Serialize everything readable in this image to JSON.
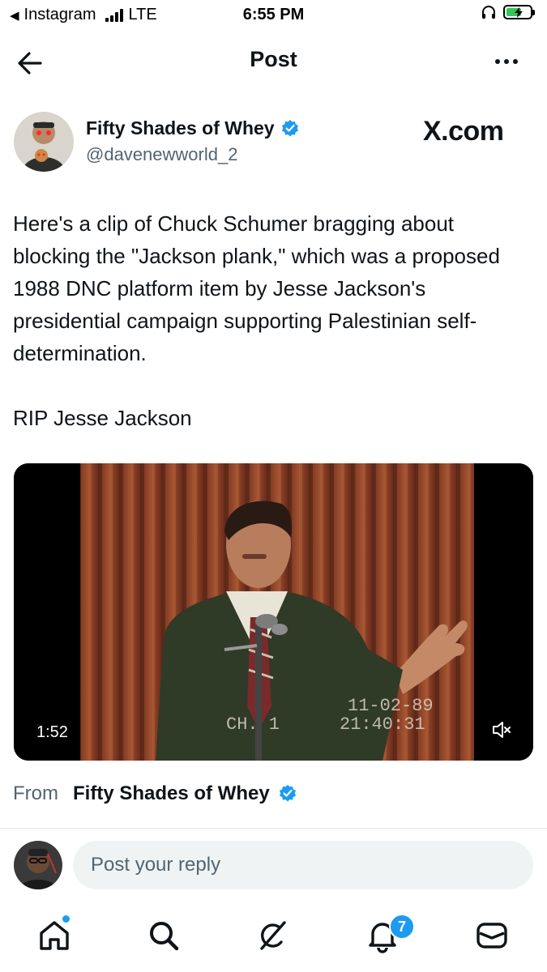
{
  "status_bar": {
    "back_app": "Instagram",
    "network": "LTE",
    "time": "6:55 PM",
    "battery_level": 0.7
  },
  "nav": {
    "title": "Post",
    "back_icon": "arrow-left-icon",
    "more_icon": "more-horizontal-icon"
  },
  "post": {
    "author_name": "Fifty Shades of Whey",
    "handle": "@davenewworld_2",
    "verified": true,
    "watermark": "X.com",
    "text_paragraphs": [
      "Here's a clip of Chuck Schumer bragging about blocking the \"Jackson plank,\" which was a proposed 1988 DNC platform item by Jesse Jackson's presidential campaign supporting Palestinian self-determination.",
      "RIP Jesse Jackson"
    ],
    "video": {
      "duration": "1:52",
      "timestamp_overlay": "11-02-89\n21:40:31",
      "channel_overlay": "CH. 1",
      "muted": true
    },
    "from_label": "From",
    "from_name": "Fifty Shades of Whey"
  },
  "reply": {
    "placeholder": "Post your reply"
  },
  "tab_bar": {
    "items": [
      "home-icon",
      "search-icon",
      "grok-icon",
      "notifications-icon",
      "messages-icon"
    ],
    "notification_count": "7"
  },
  "colors": {
    "accent": "#1d9bf0",
    "text": "#0f1419",
    "secondary_text": "#536471"
  }
}
